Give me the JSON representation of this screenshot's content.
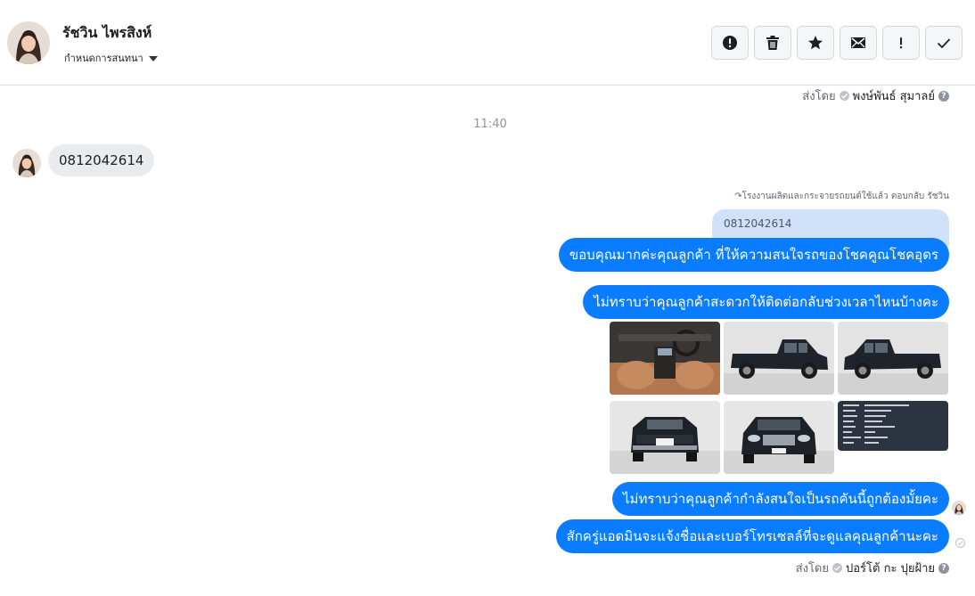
{
  "contact": {
    "name": "รัชวิน ไพรสิงห์",
    "assign_label": "กำหนดการสนทนา"
  },
  "actions": [
    {
      "name": "report",
      "icon": "alert-circle-icon"
    },
    {
      "name": "delete",
      "icon": "trash-icon"
    },
    {
      "name": "star",
      "icon": "star-icon"
    },
    {
      "name": "mark-unread",
      "icon": "envelope-icon"
    },
    {
      "name": "spam",
      "icon": "exclamation-icon"
    },
    {
      "name": "done",
      "icon": "checkmark-icon"
    }
  ],
  "thread": {
    "sent_by_top": {
      "prefix": "ส่งโดย",
      "agent": "พงษ์พันธ์ สุมาลย์"
    },
    "time": "11:40",
    "incoming": {
      "text": "0812042614"
    },
    "reply_note": "โรงงานผลิตและกระจายรถยนต์ใช้แล้ว ตอบกลับ รัชวิน",
    "quoted": "0812042614",
    "outgoing": [
      "ขอบคุณมากค่ะคุณลูกค้า ที่ให้ความสนใจรถของโชคคูณโชคอุดร",
      "ไม่ทราบว่าคุณลูกค้าสะดวกให้ติดต่อกลับช่วงเวลาไหนบ้างคะ",
      "ไม่ทราบว่าคุณลูกค้ากำลังสนใจเป็นรถคันนี้ถูกต้องมั้ยคะ",
      "สักครู่แอดมินจะแจ้งชื่อและเบอร์โทรเซลล์ที่จะดูแลคุณลูกค้านะคะ"
    ],
    "sent_by_bottom": {
      "prefix": "ส่งโดย",
      "agent": "ปอร์โต้ กะ ปุยฝ้าย"
    }
  },
  "colors": {
    "accent": "#0a7cff",
    "quoted_bg": "#cfe2fa",
    "incoming_bg": "#e9ebee"
  }
}
